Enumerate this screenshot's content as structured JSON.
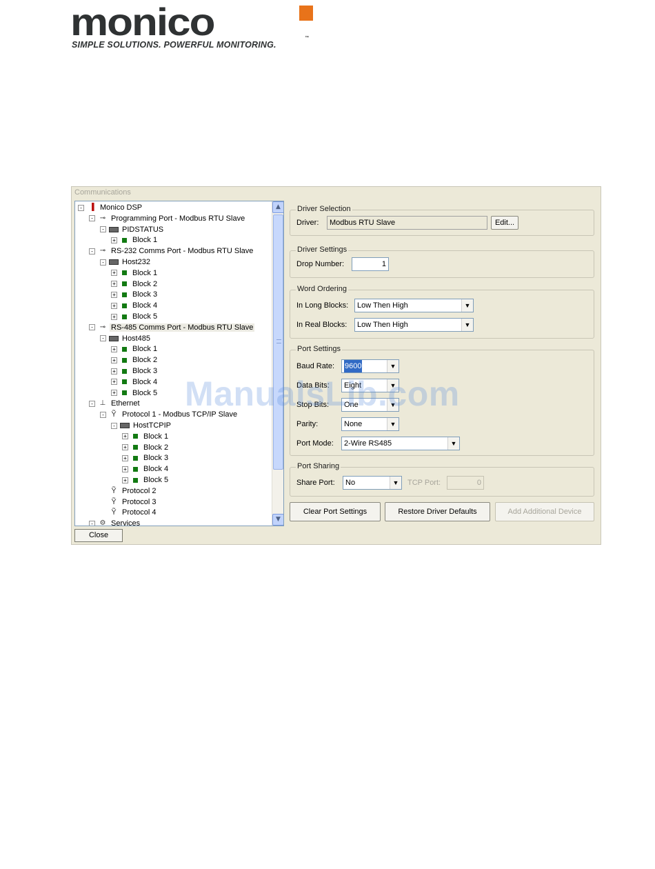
{
  "logo": {
    "wordmark": "monico",
    "tagline": "SIMPLE SOLUTIONS. POWERFUL MONITORING.",
    "trademark": "™",
    "accent_color": "#e8731a"
  },
  "window": {
    "title": "Communications",
    "close_label": "Close"
  },
  "tree": [
    {
      "label": "Monico DSP",
      "icon": "device-icon",
      "expander": "-"
    },
    {
      "label": "Programming Port - Modbus RTU Slave",
      "icon": "port-icon",
      "expander": "-"
    },
    {
      "label": "PIDSTATUS",
      "icon": "host-icon",
      "expander": "-"
    },
    {
      "label": "Block 1",
      "icon": "block-icon",
      "expander": "+"
    },
    {
      "label": "RS-232 Comms Port - Modbus RTU Slave",
      "icon": "port-icon",
      "expander": "-"
    },
    {
      "label": "Host232",
      "icon": "host-icon",
      "expander": "-"
    },
    {
      "label": "Block 1",
      "icon": "block-icon",
      "expander": "+"
    },
    {
      "label": "Block 2",
      "icon": "block-icon",
      "expander": "+"
    },
    {
      "label": "Block 3",
      "icon": "block-icon",
      "expander": "+"
    },
    {
      "label": "Block 4",
      "icon": "block-icon",
      "expander": "+"
    },
    {
      "label": "Block 5",
      "icon": "block-icon",
      "expander": "+"
    },
    {
      "label": "RS-485 Comms Port - Modbus RTU Slave",
      "icon": "port-icon",
      "expander": "-"
    },
    {
      "label": "Host485",
      "icon": "host-icon",
      "expander": "-"
    },
    {
      "label": "Block 1",
      "icon": "block-icon",
      "expander": "+"
    },
    {
      "label": "Block 2",
      "icon": "block-icon",
      "expander": "+"
    },
    {
      "label": "Block 3",
      "icon": "block-icon",
      "expander": "+"
    },
    {
      "label": "Block 4",
      "icon": "block-icon",
      "expander": "+"
    },
    {
      "label": "Block 5",
      "icon": "block-icon",
      "expander": "+"
    },
    {
      "label": "Ethernet",
      "icon": "ethernet-icon",
      "expander": "-"
    },
    {
      "label": "Protocol 1 - Modbus TCP/IP Slave",
      "icon": "protocol-icon",
      "expander": "-"
    },
    {
      "label": "HostTCPIP",
      "icon": "host-icon",
      "expander": "-"
    },
    {
      "label": "Block 1",
      "icon": "block-icon",
      "expander": "+"
    },
    {
      "label": "Block 2",
      "icon": "block-icon",
      "expander": "+"
    },
    {
      "label": "Block 3",
      "icon": "block-icon",
      "expander": "+"
    },
    {
      "label": "Block 4",
      "icon": "block-icon",
      "expander": "+"
    },
    {
      "label": "Block 5",
      "icon": "block-icon",
      "expander": "+"
    },
    {
      "label": "Protocol 2",
      "icon": "protocol-icon",
      "expander": ""
    },
    {
      "label": "Protocol 3",
      "icon": "protocol-icon",
      "expander": ""
    },
    {
      "label": "Protocol 4",
      "icon": "protocol-icon",
      "expander": ""
    },
    {
      "label": "Services",
      "icon": "services-icon",
      "expander": "-"
    }
  ],
  "selected_tree_item": "RS-485 Comms Port - Modbus RTU Slave",
  "driver_selection": {
    "legend": "Driver Selection",
    "driver_label": "Driver:",
    "driver_value": "Modbus RTU Slave",
    "edit_label": "Edit..."
  },
  "driver_settings": {
    "legend": "Driver Settings",
    "drop_label": "Drop Number:",
    "drop_value": "1"
  },
  "word_ordering": {
    "legend": "Word Ordering",
    "long_label": "In Long Blocks:",
    "long_value": "Low Then High",
    "real_label": "In Real Blocks:",
    "real_value": "Low Then High"
  },
  "port_settings": {
    "legend": "Port Settings",
    "baud_label": "Baud Rate:",
    "baud_value": "9600",
    "data_label": "Data Bits:",
    "data_value": "Eight",
    "stop_label": "Stop Bits:",
    "stop_value": "One",
    "parity_label": "Parity:",
    "parity_value": "None",
    "mode_label": "Port Mode:",
    "mode_value": "2-Wire RS485"
  },
  "port_sharing": {
    "legend": "Port Sharing",
    "share_label": "Share Port:",
    "share_value": "No",
    "tcp_label": "TCP Port:",
    "tcp_value": "0"
  },
  "actions": {
    "clear": "Clear Port Settings",
    "restore": "Restore Driver Defaults",
    "add": "Add Additional Device"
  },
  "watermark": "ManualsLib.com"
}
